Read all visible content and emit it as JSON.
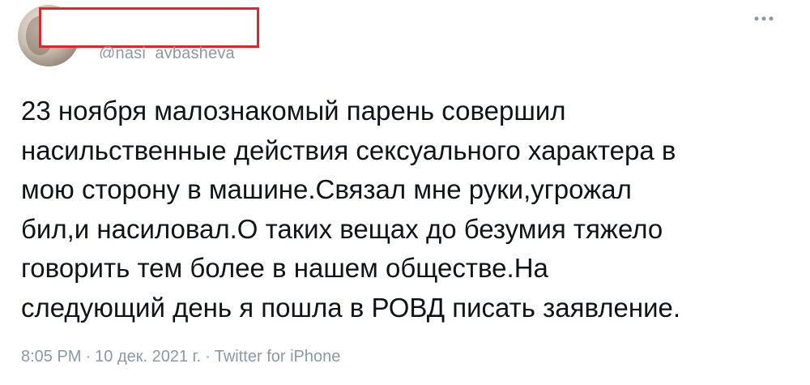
{
  "tweet": {
    "handle": "@nasi_aybasheva",
    "more_icon": "ellipsis-icon",
    "text_lines": [
      "23 ноября малознакомый парень совершил",
      "насильственные действия сексуального характера в",
      "мою сторону в машине.Связал мне руки,угрожал",
      "бил,и насиловал.О таких вещах до безумия тяжело",
      "говорить тем более в нашем обществе.На",
      "следующий день я пошла в РОВД писать заявление."
    ],
    "time": "8:05 PM",
    "separator": "·",
    "date": "10 дек. 2021 г.",
    "source": "Twitter for iPhone"
  },
  "colors": {
    "text": "#101418",
    "muted": "#8b98a5",
    "redaction_border": "#e0262b"
  }
}
